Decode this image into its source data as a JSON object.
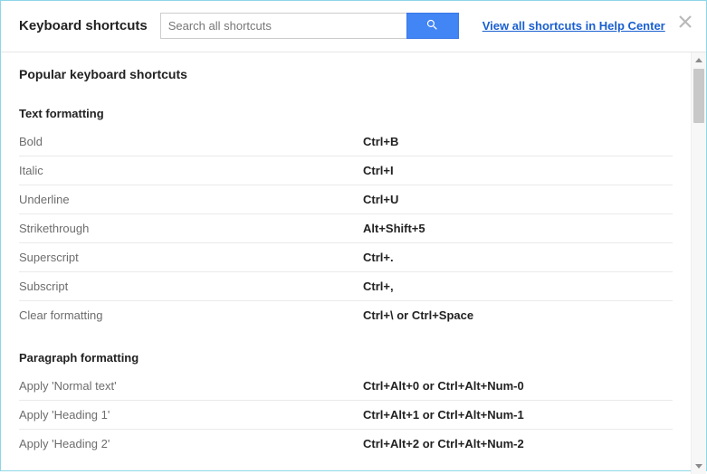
{
  "header": {
    "title": "Keyboard shortcuts",
    "search_placeholder": "Search all shortcuts",
    "help_link": "View all shortcuts in Help Center"
  },
  "popular_title": "Popular keyboard shortcuts",
  "sections": [
    {
      "title": "Text formatting",
      "rows": [
        {
          "label": "Bold",
          "keys": "Ctrl+B"
        },
        {
          "label": "Italic",
          "keys": "Ctrl+I"
        },
        {
          "label": "Underline",
          "keys": "Ctrl+U"
        },
        {
          "label": "Strikethrough",
          "keys": "Alt+Shift+5"
        },
        {
          "label": "Superscript",
          "keys": "Ctrl+."
        },
        {
          "label": "Subscript",
          "keys": "Ctrl+,"
        },
        {
          "label": "Clear formatting",
          "keys": "Ctrl+\\ or Ctrl+Space"
        }
      ]
    },
    {
      "title": "Paragraph formatting",
      "rows": [
        {
          "label": "Apply 'Normal text'",
          "keys": "Ctrl+Alt+0 or Ctrl+Alt+Num-0"
        },
        {
          "label": "Apply 'Heading 1'",
          "keys": "Ctrl+Alt+1 or Ctrl+Alt+Num-1"
        },
        {
          "label": "Apply 'Heading 2'",
          "keys": "Ctrl+Alt+2 or Ctrl+Alt+Num-2"
        }
      ]
    }
  ]
}
